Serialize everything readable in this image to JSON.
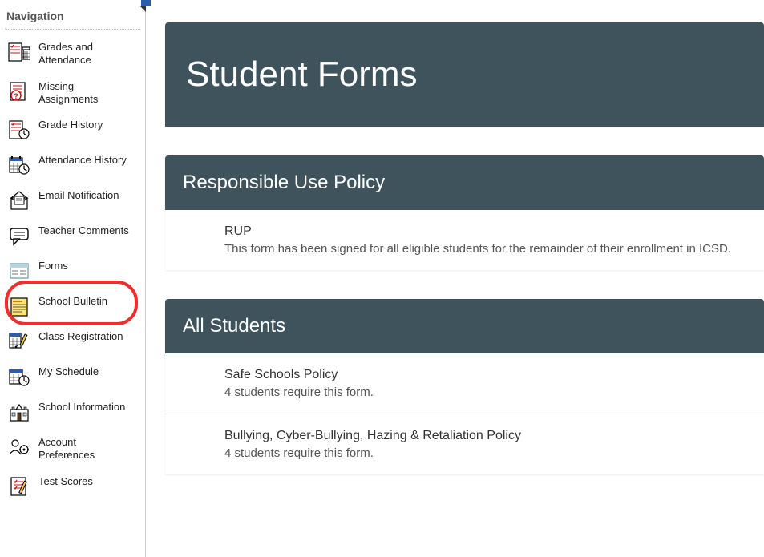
{
  "sidebar": {
    "title": "Navigation",
    "items": [
      {
        "label": "Grades and Attendance"
      },
      {
        "label": "Missing Assignments"
      },
      {
        "label": "Grade History"
      },
      {
        "label": "Attendance History"
      },
      {
        "label": "Email Notification"
      },
      {
        "label": "Teacher Comments"
      },
      {
        "label": "Forms"
      },
      {
        "label": "School Bulletin"
      },
      {
        "label": "Class Registration"
      },
      {
        "label": "My Schedule"
      },
      {
        "label": "School Information"
      },
      {
        "label": "Account Preferences"
      },
      {
        "label": "Test Scores"
      }
    ]
  },
  "page": {
    "title": "Student Forms"
  },
  "sections": [
    {
      "title": "Responsible Use Policy",
      "forms": [
        {
          "name": "RUP",
          "desc": "This form has been signed for all eligible students for the remainder of their enrollment in ICSD."
        }
      ]
    },
    {
      "title": "All Students",
      "forms": [
        {
          "name": "Safe Schools Policy",
          "desc": "4 students require this form."
        },
        {
          "name": "Bullying, Cyber-Bullying, Hazing & Retaliation Policy",
          "desc": "4 students require this form."
        }
      ]
    }
  ]
}
